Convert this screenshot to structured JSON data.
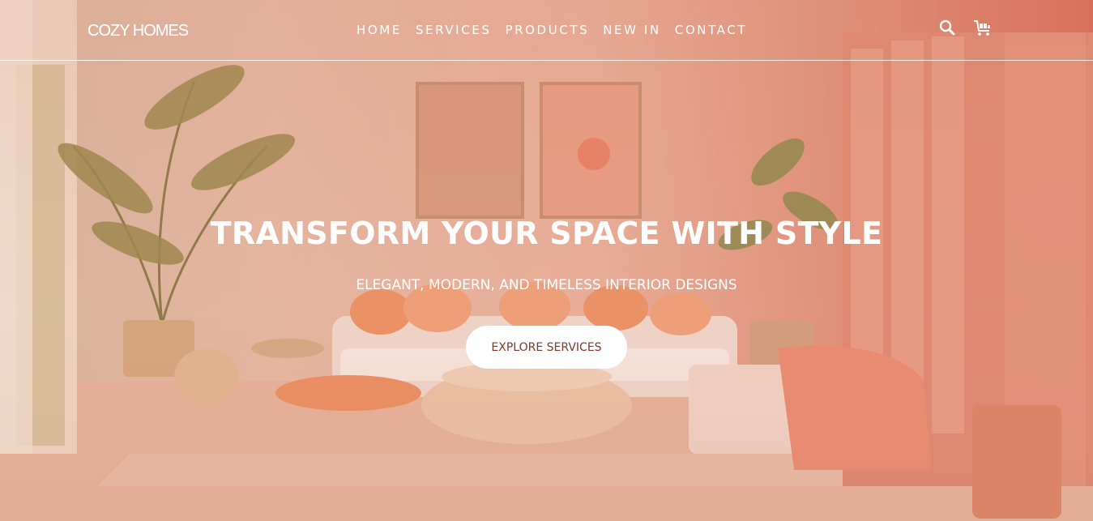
{
  "header": {
    "logo_text": "COZY HOMES",
    "nav": [
      {
        "label": "HOME"
      },
      {
        "label": "SERVICES"
      },
      {
        "label": "PRODUCTS"
      },
      {
        "label": "NEW IN"
      },
      {
        "label": "CONTACT"
      }
    ],
    "icons": [
      "search-icon",
      "cart-icon"
    ]
  },
  "hero": {
    "title": "TRANSFORM YOUR SPACE WITH STYLE",
    "subtitle": "ELEGANT, MODERN, AND TIMELESS INTERIOR DESIGNS",
    "cta_label": "EXPLORE SERVICES"
  },
  "colors": {
    "overlay": "#e8a58f",
    "cta_background": "#ffffff",
    "cta_text": "#7a3b2c",
    "text": "#ffffff"
  }
}
